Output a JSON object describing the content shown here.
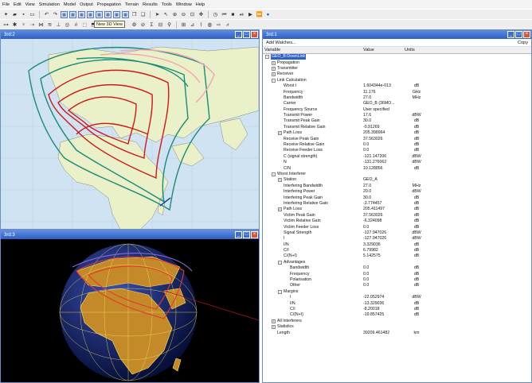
{
  "menubar": [
    "File",
    "Edit",
    "View",
    "Simulation",
    "Model",
    "Output",
    "Propagation",
    "Terrain",
    "Results",
    "Tools",
    "Window",
    "Help"
  ],
  "toolbar": {
    "tooltip": "New 3D View"
  },
  "windows": {
    "map": {
      "title": "3rd:2"
    },
    "globe": {
      "title": "3rd:3"
    },
    "table": {
      "title": "3rd:1"
    }
  },
  "table": {
    "add_watches": "Add Watches...",
    "copy": "Copy",
    "headers": {
      "variable": "Variable",
      "value": "Value",
      "units": "Units"
    },
    "rows": [
      {
        "level": 0,
        "exp": "-",
        "label": "GEO_B:DownLink",
        "value": "",
        "units": "",
        "selected": true
      },
      {
        "level": 1,
        "exp": "+",
        "label": "Propagation",
        "value": "",
        "units": ""
      },
      {
        "level": 1,
        "exp": "+",
        "label": "Transmitter",
        "value": "",
        "units": ""
      },
      {
        "level": 1,
        "exp": "+",
        "label": "Receiver",
        "value": "",
        "units": ""
      },
      {
        "level": 1,
        "exp": "-",
        "label": "Link Calculation",
        "value": "",
        "units": ""
      },
      {
        "level": 2,
        "exp": "",
        "label": "Worst I",
        "value": "1.604344e-013",
        "units": "dB"
      },
      {
        "level": 2,
        "exp": "",
        "label": "Frequency",
        "value": "11.176",
        "units": "GHz"
      },
      {
        "level": 2,
        "exp": "",
        "label": "Bandwidth",
        "value": "27.0",
        "units": "MHz"
      },
      {
        "level": 2,
        "exp": "",
        "label": "Carrier",
        "value": "GEO_B (36MO...",
        "units": ""
      },
      {
        "level": 2,
        "exp": "",
        "label": "Frequency Source",
        "value": "User specified",
        "units": ""
      },
      {
        "level": 2,
        "exp": "",
        "label": "Transmit Power",
        "value": "17.6",
        "units": "dBW"
      },
      {
        "level": 2,
        "exp": "",
        "label": "Transmit Peak Gain",
        "value": "30.0",
        "units": "dB"
      },
      {
        "level": 2,
        "exp": "",
        "label": "Transmit Relative Gain",
        "value": "-0.91269",
        "units": "dB"
      },
      {
        "level": 2,
        "exp": "+",
        "label": "Path Loss",
        "value": "205.398964",
        "units": "dB"
      },
      {
        "level": 2,
        "exp": "",
        "label": "Receive Peak Gain",
        "value": "37.563026",
        "units": "dB"
      },
      {
        "level": 2,
        "exp": "",
        "label": "Receive Relative Gain",
        "value": "0.0",
        "units": "dB"
      },
      {
        "level": 2,
        "exp": "",
        "label": "Receive Feeder Loss",
        "value": "0.0",
        "units": "dB"
      },
      {
        "level": 2,
        "exp": "",
        "label": "C (signal strength)",
        "value": "-121.147206",
        "units": "dBW"
      },
      {
        "level": 2,
        "exp": "",
        "label": "N",
        "value": "-131.276062",
        "units": "dBW"
      },
      {
        "level": 2,
        "exp": "",
        "label": "C/N",
        "value": "10.128856",
        "units": "dB"
      },
      {
        "level": 1,
        "exp": "-",
        "label": "Worst Interferer",
        "value": "",
        "units": ""
      },
      {
        "level": 2,
        "exp": "+",
        "label": "Station",
        "value": "GEO_A",
        "units": ""
      },
      {
        "level": 2,
        "exp": "",
        "label": "Interfering Bandwidth",
        "value": "27.0",
        "units": "MHz"
      },
      {
        "level": 2,
        "exp": "",
        "label": "Interfering Power",
        "value": "20.0",
        "units": "dBW"
      },
      {
        "level": 2,
        "exp": "",
        "label": "Interfering Peak Gain",
        "value": "30.0",
        "units": "dB"
      },
      {
        "level": 2,
        "exp": "",
        "label": "Interfering Relative Gain",
        "value": "-3.774457",
        "units": "dB"
      },
      {
        "level": 2,
        "exp": "+",
        "label": "Path Loss",
        "value": "205.411497",
        "units": "dB"
      },
      {
        "level": 2,
        "exp": "",
        "label": "Victim Peak Gain",
        "value": "37.563026",
        "units": "dB"
      },
      {
        "level": 2,
        "exp": "",
        "label": "Victim Relative Gain",
        "value": "-6.324098",
        "units": "dB"
      },
      {
        "level": 2,
        "exp": "",
        "label": "Victim Feeder Loss",
        "value": "0.0",
        "units": "dB"
      },
      {
        "level": 2,
        "exp": "",
        "label": "Signal Strength",
        "value": "-127.947026",
        "units": "dBW"
      },
      {
        "level": 2,
        "exp": "",
        "label": "I",
        "value": "-127.947026",
        "units": "dBW"
      },
      {
        "level": 2,
        "exp": "",
        "label": "I/N",
        "value": "3.329036",
        "units": "dB"
      },
      {
        "level": 2,
        "exp": "",
        "label": "C/I",
        "value": "6.79982",
        "units": "dB"
      },
      {
        "level": 2,
        "exp": "",
        "label": "C/(N+I)",
        "value": "5.142575",
        "units": "dB"
      },
      {
        "level": 2,
        "exp": "-",
        "label": "Advantages",
        "value": "",
        "units": ""
      },
      {
        "level": 3,
        "exp": "",
        "label": "Bandwidth",
        "value": "0.0",
        "units": "dB"
      },
      {
        "level": 3,
        "exp": "",
        "label": "Frequency",
        "value": "0.0",
        "units": "dB"
      },
      {
        "level": 3,
        "exp": "",
        "label": "Polarisation",
        "value": "0.0",
        "units": "dB"
      },
      {
        "level": 3,
        "exp": "",
        "label": "Other",
        "value": "0.0",
        "units": "dB"
      },
      {
        "level": 2,
        "exp": "-",
        "label": "Margins",
        "value": "",
        "units": ""
      },
      {
        "level": 3,
        "exp": "",
        "label": "I",
        "value": "-22.052974",
        "units": "dBW"
      },
      {
        "level": 3,
        "exp": "",
        "label": "I/N",
        "value": "-13.329036",
        "units": "dB"
      },
      {
        "level": 3,
        "exp": "",
        "label": "C/I",
        "value": "-8.20018",
        "units": "dB"
      },
      {
        "level": 3,
        "exp": "",
        "label": "C/(N+I)",
        "value": "-19.857425",
        "units": "dB"
      },
      {
        "level": 1,
        "exp": "+",
        "label": "All Interferers",
        "value": "",
        "units": ""
      },
      {
        "level": 1,
        "exp": "+",
        "label": "Statistics",
        "value": "",
        "units": ""
      },
      {
        "level": 1,
        "exp": "",
        "label": "Length",
        "value": "39209.461482",
        "units": "km"
      }
    ]
  },
  "colors": {
    "title_bar": "#2e5fc4",
    "ocean": "#cfe3f3",
    "land": "#eaf0c8",
    "contour_green": "#1a8c7a",
    "contour_red": "#d01818",
    "contour_pink": "#f3a3b4"
  }
}
